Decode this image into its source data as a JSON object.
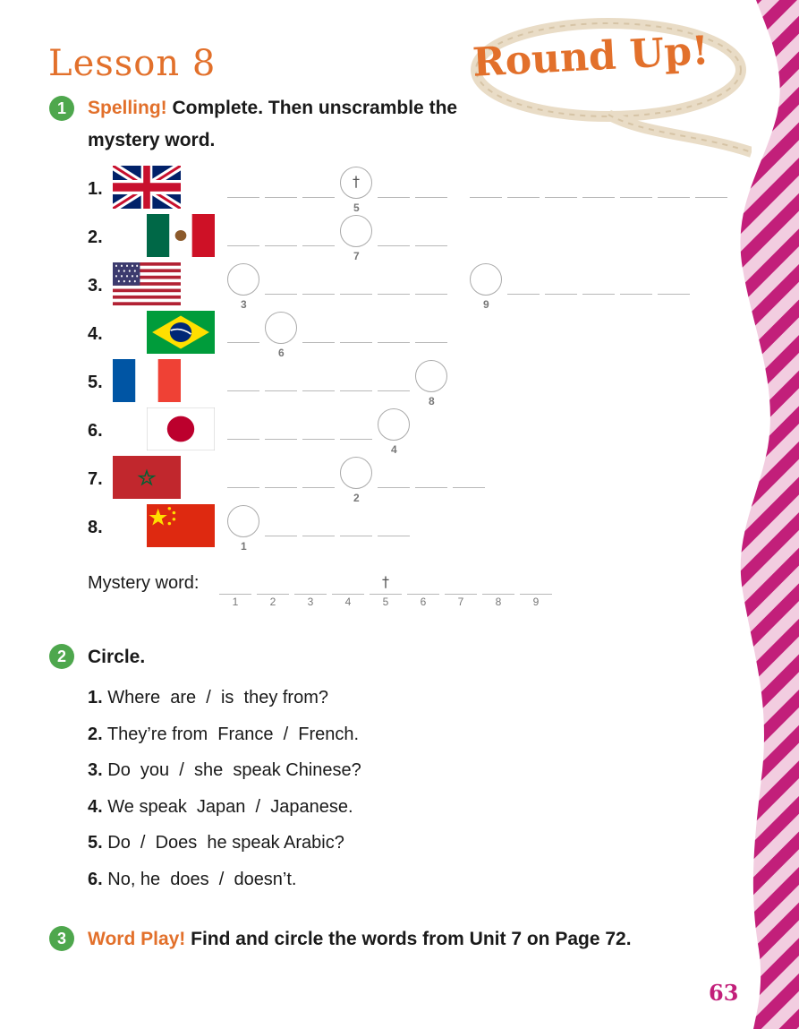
{
  "lesson_title": "Lesson 8",
  "banner": "Round Up!",
  "section1": {
    "number": "1",
    "label": "Spelling!",
    "instruction_line1": "Complete. Then unscramble the",
    "instruction_line2": "mystery word."
  },
  "spelling_rows": [
    {
      "num": "1.",
      "flag": "united-kingdom",
      "circle_index": "5",
      "circle_mark": "†"
    },
    {
      "num": "2.",
      "flag": "mexico",
      "circle_index": "7"
    },
    {
      "num": "3.",
      "flag": "united-states",
      "circle_index": "3",
      "circle_index_b": "9"
    },
    {
      "num": "4.",
      "flag": "brazil",
      "circle_index": "6"
    },
    {
      "num": "5.",
      "flag": "france",
      "circle_index": "8"
    },
    {
      "num": "6.",
      "flag": "japan",
      "circle_index": "4"
    },
    {
      "num": "7.",
      "flag": "morocco",
      "circle_index": "2"
    },
    {
      "num": "8.",
      "flag": "china",
      "circle_index": "1"
    }
  ],
  "mystery": {
    "label": "Mystery word:",
    "slots": [
      "1",
      "2",
      "3",
      "4",
      "5",
      "6",
      "7",
      "8",
      "9"
    ],
    "mark": "†"
  },
  "section2": {
    "number": "2",
    "title": "Circle.",
    "items": [
      {
        "n": "1.",
        "text": "Where  are  /  is  they from?"
      },
      {
        "n": "2.",
        "text": "They’re from  France  /  French."
      },
      {
        "n": "3.",
        "text": "Do  you  /  she  speak Chinese?"
      },
      {
        "n": "4.",
        "text": "We speak  Japan  /  Japanese."
      },
      {
        "n": "5.",
        "text": "Do  /  Does  he speak Arabic?"
      },
      {
        "n": "6.",
        "text": "No, he  does  /  doesn’t."
      }
    ]
  },
  "section3": {
    "number": "3",
    "label": "Word Play!",
    "instruction": "Find and circle the words from Unit 7 on Page 72."
  },
  "page_number": "63",
  "colors": {
    "accent_orange": "#e2702b",
    "badge_green": "#4ea74d",
    "stripe_magenta": "#c21f7a",
    "stripe_pink": "#f2cde0"
  }
}
